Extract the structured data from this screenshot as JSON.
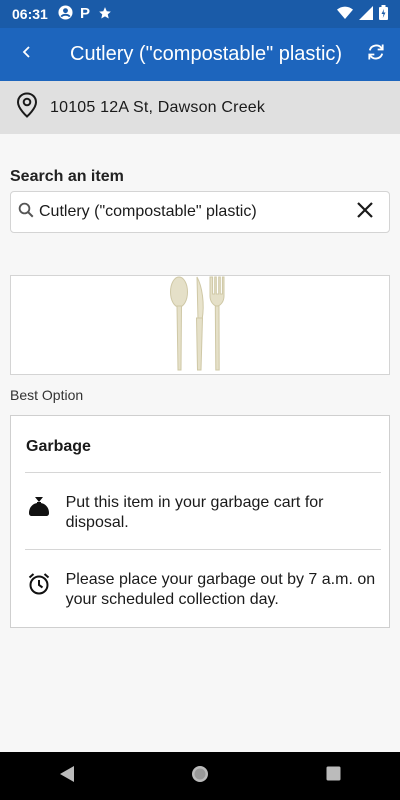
{
  "status_bar": {
    "time": "06:31",
    "left_icons": [
      "account-circle-icon",
      "parking-icon",
      "star-icon"
    ],
    "right_icons": [
      "wifi-icon",
      "signal-icon",
      "battery-icon"
    ]
  },
  "app_bar": {
    "title": "Cutlery (\"compostable\" plastic)",
    "back_icon": "chevron-left-icon",
    "refresh_icon": "refresh-icon",
    "color": "#1d65bd"
  },
  "address": {
    "icon": "location-pin-icon",
    "text": "10105 12A St, Dawson Creek"
  },
  "search": {
    "label": "Search an item",
    "value": "Cutlery (\"compostable\" plastic)",
    "search_icon": "search-icon",
    "clear_icon": "close-icon"
  },
  "item_image": {
    "icon": "cutlery-icon"
  },
  "best_option_label": "Best Option",
  "option": {
    "title": "Garbage",
    "rows": [
      {
        "icon": "garbage-bag-icon",
        "text": "Put this item in your garbage cart for disposal."
      },
      {
        "icon": "alarm-clock-icon",
        "text": "Please place your garbage out by 7 a.m. on your scheduled collection day."
      }
    ]
  },
  "nav_bar": {
    "back_icon": "nav-back-icon",
    "home_icon": "nav-home-icon",
    "recents_icon": "nav-recents-icon"
  }
}
